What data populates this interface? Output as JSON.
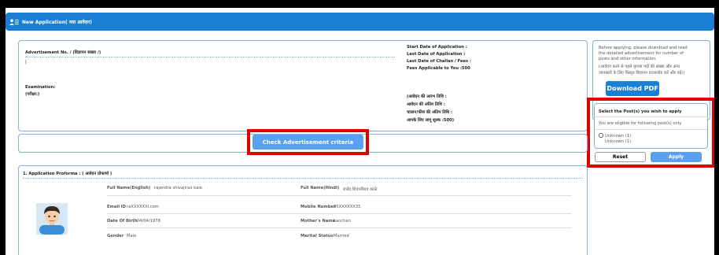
{
  "header": {
    "title": "New Application( नया आवेदन)"
  },
  "advert": {
    "label": "Advertisement No. / (विज्ञापन संख्या /)",
    "value": "|",
    "exam_label": "Examination:",
    "exam_label_hi": "(परीक्षा:)"
  },
  "dates": {
    "start": "Start Date of Application :",
    "last": "Last Date of Application :",
    "challan": "Last Date of Challan / Fees :",
    "fees": "Fees Applicable to You :500",
    "start_hi": "(आवेदन की आरंभ तिथि :",
    "last_hi": "आवेदन की अंतिम तिथि :",
    "challan_hi": "चालान/फीस की अंतिम तिथि :",
    "fees_hi": "आपके लिए लागू शुल्क :500)"
  },
  "info": {
    "line1": "Before applying, please download and read",
    "line2": "the detailed advertisement for number of",
    "line3": "posts and other information.",
    "line4": "(आवेदन करने से पहले कृपया पदों की संख्या और अन्य",
    "line5": "जानकारी के लिए विस्तृत विज्ञापन डाउनलोड करें और पढ़ें।)",
    "download_label": "Download PDF"
  },
  "posts": {
    "title": "Select the Post(s) you wish to apply",
    "eligible": "You are eligible for following post(s) only",
    "option": "Unknown (1)",
    "option_sub": "Unknown (1)",
    "option_checked": false
  },
  "actions": {
    "reset": "Reset",
    "apply": "Apply"
  },
  "criteria": {
    "label": "Check Advertisement criteria"
  },
  "proforma": {
    "title": "1. Application Proforma : ( आवेदन प्रोफार्मा )",
    "full_name_en_label": "Full Name(English)",
    "full_name_en_value": "rajendra shivajirao kale",
    "full_name_hi_label": "Full Name(Hindi)",
    "full_name_hi_value": "राजेंद्र शिवाजीराव काळे",
    "email_label": "Email ID",
    "email_value": "raXXXXXXl.com",
    "mobile_label": "Mobile Number",
    "mobile_value": "95XXXXXX35",
    "dob_label": "Date Of Birth",
    "dob_value": "04/04/1978",
    "mother_label": "Mother's Name",
    "mother_value": "kanchan",
    "gender_label": "Gender",
    "gender_value": "Male",
    "marital_label": "Marital Status",
    "marital_value": "Married"
  },
  "colors": {
    "accent": "#1a7fd4",
    "highlight": "#e00000"
  }
}
